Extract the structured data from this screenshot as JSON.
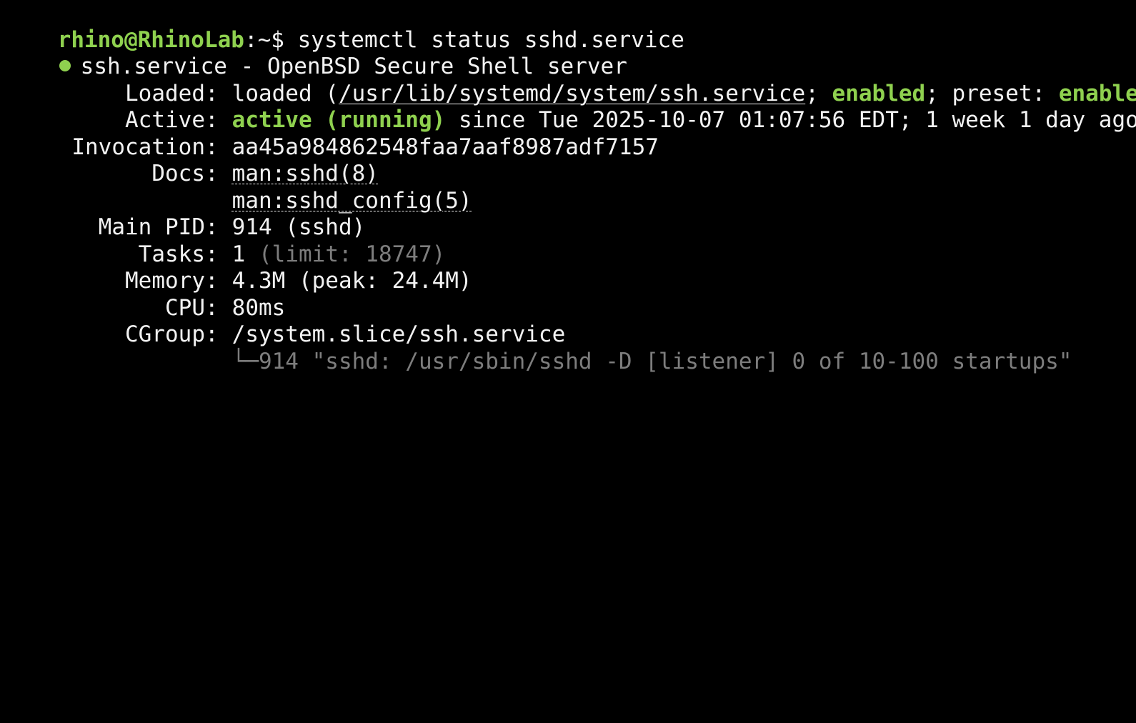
{
  "prompt": {
    "user_host": "rhino@RhinoLab",
    "path": ":~",
    "symbol": "$",
    "command": "systemctl status sshd.service"
  },
  "unit_line": {
    "bullet": "●",
    "title": "ssh.service - OpenBSD Secure Shell server"
  },
  "loaded": {
    "label": "Loaded:",
    "prefix": "loaded (",
    "path": "/usr/lib/systemd/system/ssh.service",
    "sep1": ";",
    "state": "enabled",
    "sep2": "; preset:",
    "preset": "enabled",
    "suffix": ")"
  },
  "active": {
    "label": "Active:",
    "state": "active (running)",
    "since": "since Tue 2025-10-07 01:07:56 EDT; 1 week 1 day ago"
  },
  "invocation": {
    "label": "Invocation:",
    "value": "aa45a984862548faa7aaf8987adf7157"
  },
  "docs": {
    "label": "Docs:",
    "items": [
      "man:sshd(8)",
      "man:sshd_config(5)"
    ]
  },
  "main_pid": {
    "label": "Main PID:",
    "value": "914 (sshd)"
  },
  "tasks": {
    "label": "Tasks:",
    "value": "1",
    "limit": "(limit: 18747)"
  },
  "memory": {
    "label": "Memory:",
    "value": "4.3M (peak: 24.4M)"
  },
  "cpu": {
    "label": "CPU:",
    "value": "80ms"
  },
  "cgroup": {
    "label": "CGroup:",
    "value": "/system.slice/ssh.service",
    "tree_branch": "└─",
    "process": "914 \"sshd: /usr/sbin/sshd -D [listener] 0 of 10-100 startups\""
  },
  "colors": {
    "background": "#000000",
    "text": "#f2f2f2",
    "green": "#8fd14f",
    "dim": "#7d7d7d"
  }
}
